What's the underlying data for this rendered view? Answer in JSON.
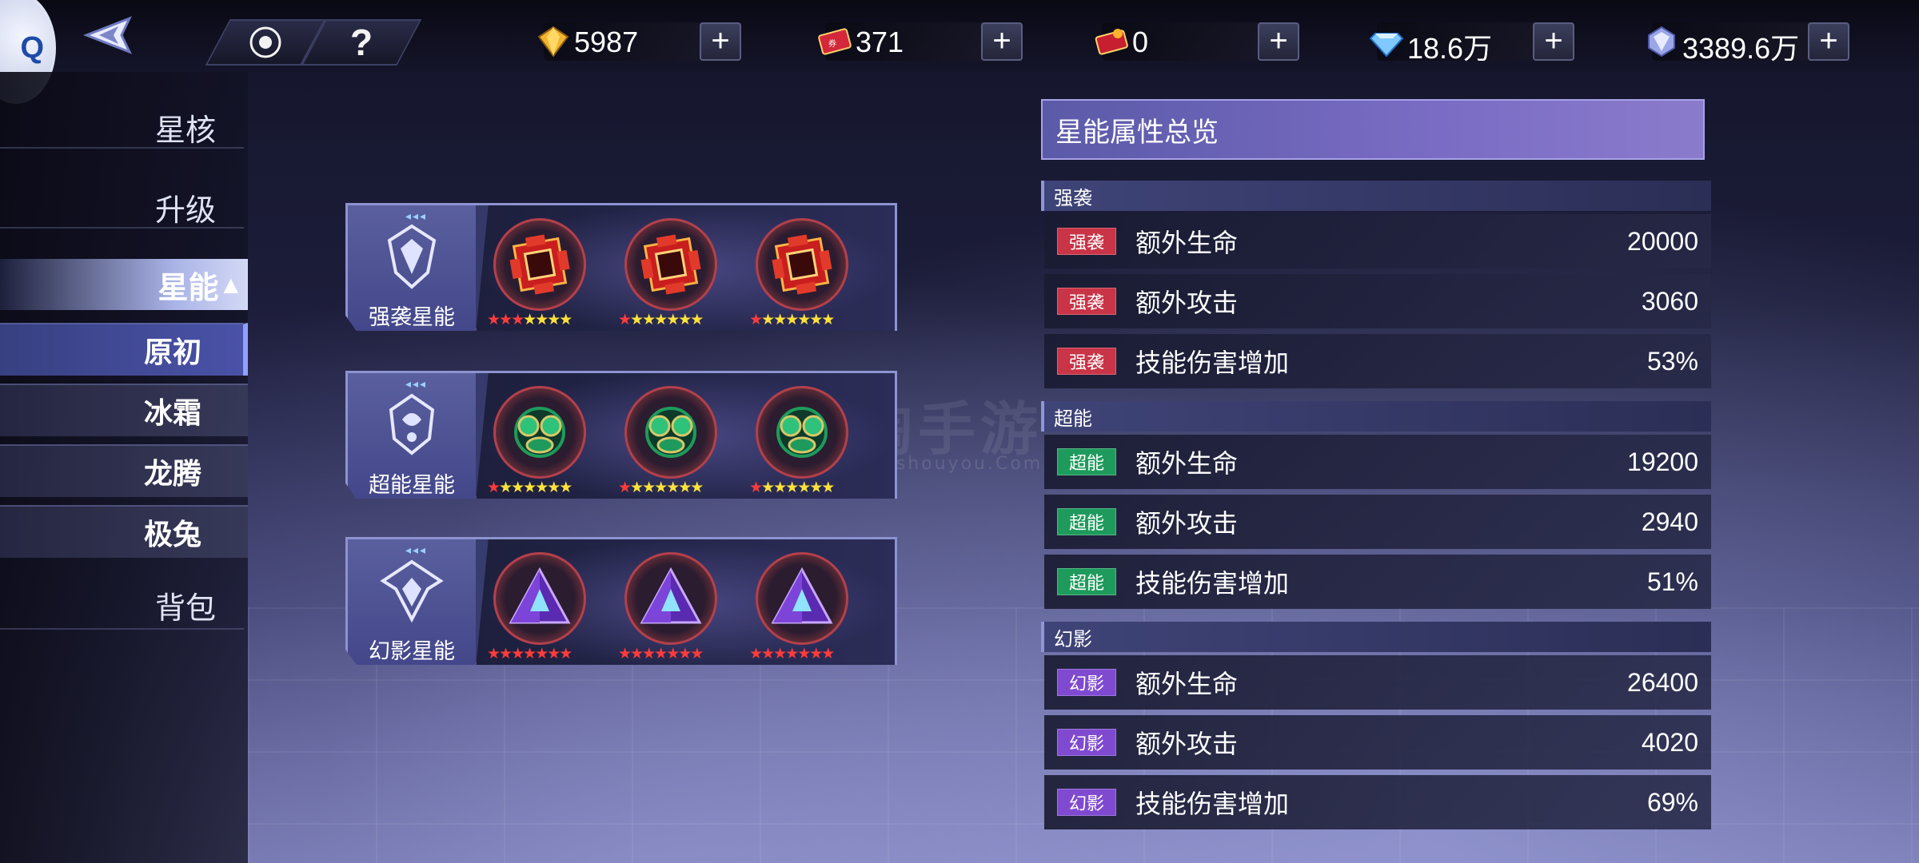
{
  "colors": {
    "qiangxi": "#c93447",
    "chaoneng": "#1e9b5c",
    "huanying": "#7f4ad0",
    "accent": "#7a6cc4"
  },
  "currencies": [
    {
      "icon": "gold-gem-icon",
      "value": "5987"
    },
    {
      "icon": "red-ticket-icon",
      "value": "371"
    },
    {
      "icon": "red-coupon-icon",
      "value": "0"
    },
    {
      "icon": "blue-diamond-icon",
      "value": "18.6万"
    },
    {
      "icon": "crystal-icon",
      "value": "3389.6万"
    }
  ],
  "plus_label": "+",
  "help_label": "?",
  "avatar_letter": "Q",
  "sidebar": {
    "main": [
      "星核",
      "升级"
    ],
    "active": "星能",
    "active_arrow": "▲",
    "sub": [
      "原初",
      "冰霜",
      "龙腾",
      "极兔"
    ],
    "bottom": "背包"
  },
  "panels": [
    {
      "label": "强袭星能",
      "dots": "◂◂◂",
      "slots": [
        {
          "red": 3,
          "yellow": 4,
          "icon": "red-cube-core-icon"
        },
        {
          "red": 1,
          "yellow": 6,
          "icon": "red-cube-core-icon"
        },
        {
          "red": 1,
          "yellow": 6,
          "icon": "red-cube-core-icon"
        }
      ]
    },
    {
      "label": "超能星能",
      "dots": "◂◂◂",
      "slots": [
        {
          "red": 1,
          "yellow": 6,
          "icon": "green-orb-core-icon"
        },
        {
          "red": 1,
          "yellow": 6,
          "icon": "green-orb-core-icon"
        },
        {
          "red": 1,
          "yellow": 6,
          "icon": "green-orb-core-icon"
        }
      ]
    },
    {
      "label": "幻影星能",
      "dots": "◂◂◂",
      "slots": [
        {
          "red": 7,
          "yellow": 0,
          "icon": "purple-pyramid-core-icon"
        },
        {
          "red": 7,
          "yellow": 0,
          "icon": "purple-pyramid-core-icon"
        },
        {
          "red": 7,
          "yellow": 0,
          "icon": "purple-pyramid-core-icon"
        }
      ]
    }
  ],
  "overview": {
    "title": "星能属性总览",
    "sections": [
      {
        "name": "强袭",
        "badge": "强袭",
        "color_key": "qiangxi",
        "rows": [
          {
            "name": "额外生命",
            "value": "20000"
          },
          {
            "name": "额外攻击",
            "value": "3060"
          },
          {
            "name": "技能伤害增加",
            "value": "53%"
          }
        ]
      },
      {
        "name": "超能",
        "badge": "超能",
        "color_key": "chaoneng",
        "rows": [
          {
            "name": "额外生命",
            "value": "19200"
          },
          {
            "name": "额外攻击",
            "value": "2940"
          },
          {
            "name": "技能伤害增加",
            "value": "51%"
          }
        ]
      },
      {
        "name": "幻影",
        "badge": "幻影",
        "color_key": "huanying",
        "rows": [
          {
            "name": "额外生命",
            "value": "26400"
          },
          {
            "name": "额外攻击",
            "value": "4020"
          },
          {
            "name": "技能伤害增加",
            "value": "69%"
          }
        ]
      }
    ]
  },
  "watermark": {
    "main": "淘手游",
    "sub": "Taoshouyou.Com"
  }
}
